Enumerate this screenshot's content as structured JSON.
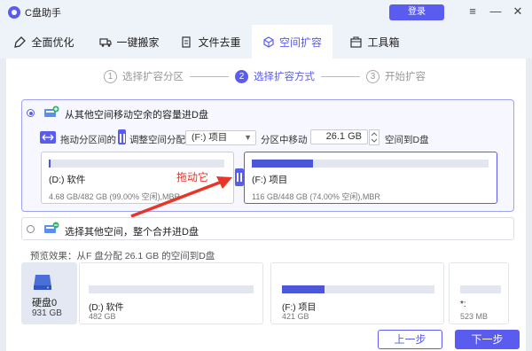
{
  "app": {
    "title": "C盘助手",
    "login_label": "登录"
  },
  "window_controls": {
    "menu": "≡",
    "minimize": "—",
    "close": "✕"
  },
  "nav": {
    "tabs": [
      {
        "label": "全面优化",
        "icon": "broom-icon",
        "active": false
      },
      {
        "label": "一键搬家",
        "icon": "truck-icon",
        "active": false
      },
      {
        "label": "文件去重",
        "icon": "document-icon",
        "active": false
      },
      {
        "label": "空间扩容",
        "icon": "expand-icon",
        "active": true
      },
      {
        "label": "工具箱",
        "icon": "toolbox-icon",
        "active": false
      }
    ]
  },
  "steps": [
    {
      "num": "1",
      "label": "选择扩容分区",
      "active": false
    },
    {
      "num": "2",
      "label": "选择扩容方式",
      "active": true
    },
    {
      "num": "3",
      "label": "开始扩容",
      "active": false
    }
  ],
  "option1": {
    "label": "从其他空间移动空余的容量进D盘",
    "selected": true,
    "toolbar": {
      "drag_hint": "拖动分区间的",
      "adjust_label": "调整空间分配",
      "source_partition": "(F:) 项目",
      "move_from_label": "分区中移动",
      "amount": "26.1 GB",
      "move_to_label": "空间到D盘"
    },
    "left_partition": {
      "name": "(D:) 软件",
      "info": "4.68 GB/482 GB (99.00% 空闲),MBR",
      "used_fraction": 0.01
    },
    "right_partition": {
      "name": "(F:) 项目",
      "info": "116 GB/448 GB (74.00% 空闲),MBR",
      "used_fraction": 0.26
    },
    "annotation": "拖动它"
  },
  "option2": {
    "label": "选择其他空间，整个合并进D盘",
    "selected": false
  },
  "preview": {
    "label": "预览效果：从F 盘分配 26.1 GB 的空间到D盘",
    "disk": {
      "name": "硬盘0",
      "size": "931 GB"
    },
    "partitions": [
      {
        "name": "(D:) 软件",
        "size": "482 GB",
        "used_fraction": 0.0
      },
      {
        "name": "(F:) 项目",
        "size": "421 GB",
        "used_fraction": 0.28
      },
      {
        "name": "*:",
        "size": "523 MB",
        "used_fraction": 0.0
      }
    ]
  },
  "buttons": {
    "prev": "上一步",
    "next": "下一步"
  }
}
